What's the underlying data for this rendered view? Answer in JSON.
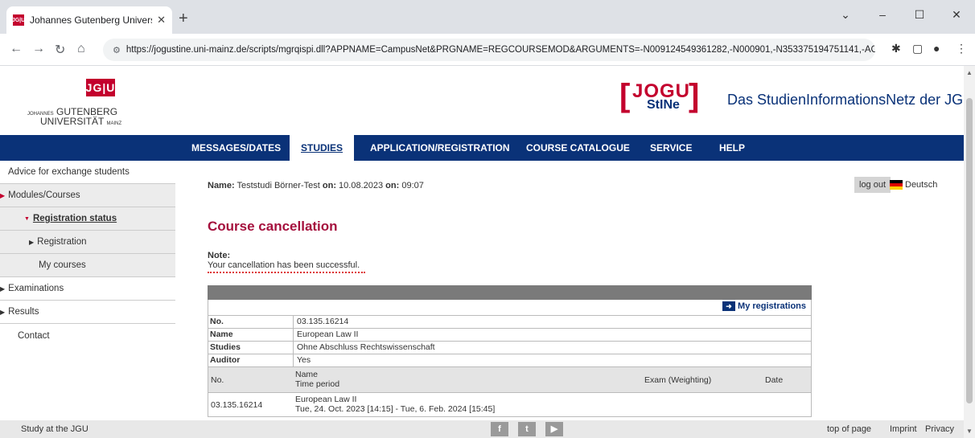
{
  "browser": {
    "tab_title": "Johannes Gutenberg Universität",
    "tab_favicon": "JG|U",
    "url": "https://jogustine.uni-mainz.de/scripts/mgrqispi.dll?APPNAME=CampusNet&PRGNAME=REGCOURSEMOD&ARGUMENTS=-N009124549361282,-N000901,-N353375194751141,-ACODA,..."
  },
  "header": {
    "university_mark": "JG|U",
    "university_name_prefix": "JOHANNES",
    "university_name_1": "GUTENBERG",
    "university_name_2": "UNIVERSITÄT",
    "university_name_suffix": "MAINZ",
    "stine_logo_top": "JOGU",
    "stine_logo_bottom": "StINe",
    "portal_title": "Das StudienInformationsNetz der JG|U"
  },
  "mainnav": {
    "items": [
      "MESSAGES/DATES",
      "STUDIES",
      "APPLICATION/REGISTRATION",
      "COURSE CATALOGUE",
      "SERVICE",
      "HELP"
    ]
  },
  "sidebar": {
    "items": [
      "Advice for exchange students",
      "Modules/Courses",
      "Registration status",
      "Registration",
      "My courses",
      "Examinations",
      "Results",
      "Contact"
    ]
  },
  "user": {
    "name_label": "Name:",
    "name": "Teststudi Börner-Test",
    "on_label": "on:",
    "date": "10.08.2023",
    "on_label2": "on:",
    "time": "09:07",
    "logout": "log out",
    "language": "Deutsch"
  },
  "main": {
    "heading": "Course cancellation",
    "note_label": "Note:",
    "note_text": "Your cancellation has been successful.",
    "my_registrations": "My registrations",
    "details": [
      {
        "key": "No.",
        "value": "03.135.16214"
      },
      {
        "key": "Name",
        "value": "European Law II"
      },
      {
        "key": "Studies",
        "value": "Ohne Abschluss Rechtswissenschaft"
      },
      {
        "key": "Auditor",
        "value": "Yes"
      }
    ],
    "sub_headers": {
      "no": "No.",
      "name": "Name",
      "time_period": "Time period",
      "exam": "Exam (Weighting)",
      "date": "Date"
    },
    "sub_row": {
      "no": "03.135.16214",
      "name": "European Law II",
      "time_period": "Tue, 24. Oct. 2023 [14:15] - Tue, 6. Feb. 2024 [15:45]"
    }
  },
  "footer": {
    "study": "Study at the JGU",
    "top": "top of page",
    "imprint": "Imprint",
    "privacy": "Privacy"
  }
}
